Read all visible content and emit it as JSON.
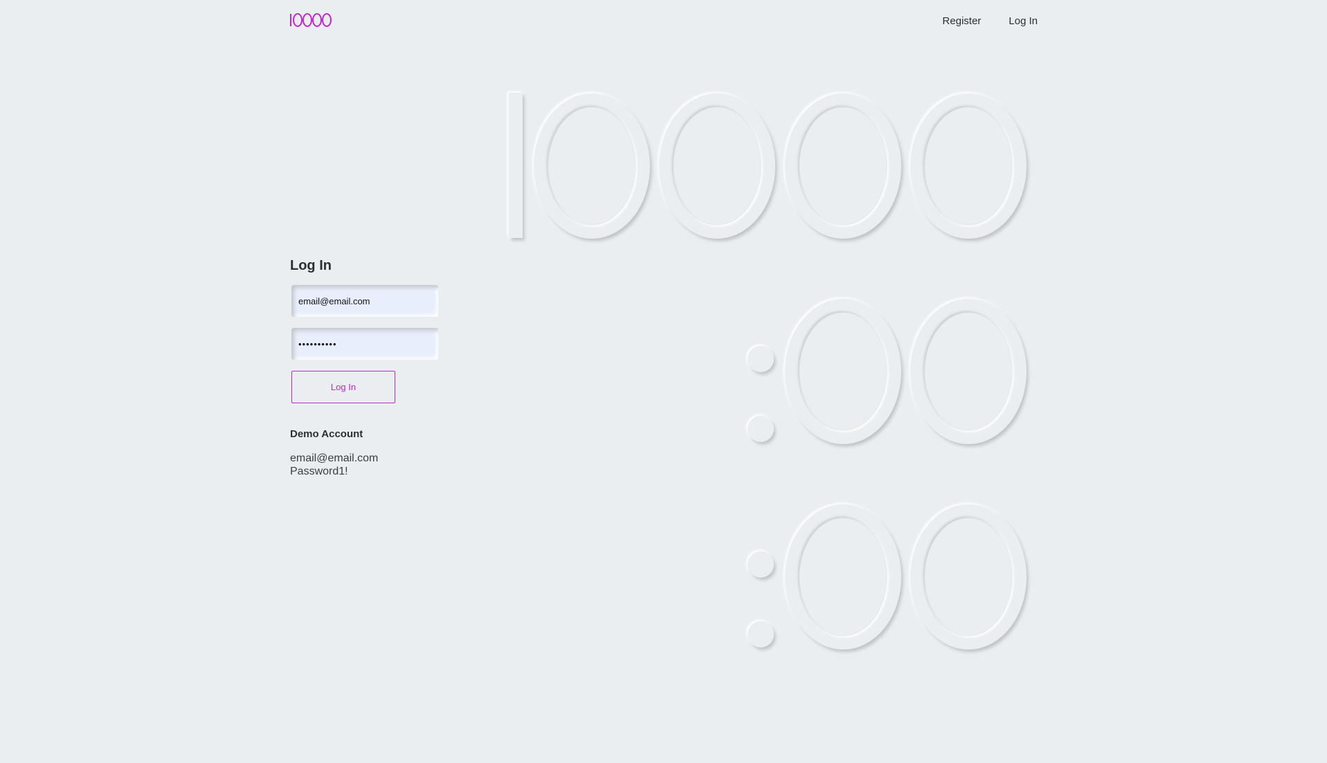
{
  "header": {
    "logo_text": "10000",
    "nav": {
      "register_label": "Register",
      "login_label": "Log In"
    }
  },
  "hero": {
    "hours": "10000",
    "minutes": ":00",
    "seconds": ":00"
  },
  "login_form": {
    "title": "Log In",
    "email_value": "email@email.com",
    "password_value": "••••••••••",
    "submit_label": "Log In"
  },
  "demo_account": {
    "title": "Demo Account",
    "email": "email@email.com",
    "password": "Password1!"
  },
  "colors": {
    "background": "#eaeef1",
    "accent": "#c128c8",
    "text": "#2c2f33"
  }
}
